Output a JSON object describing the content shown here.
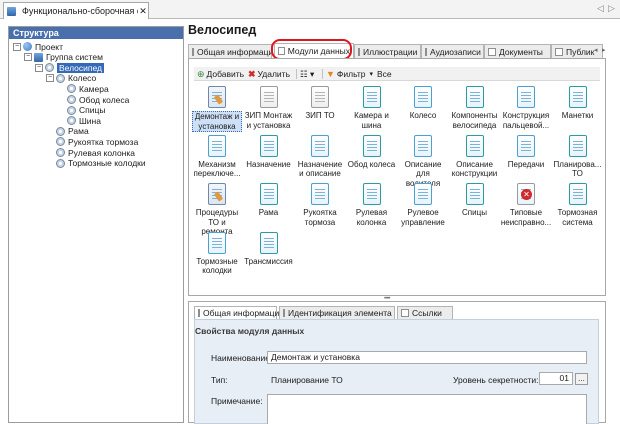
{
  "doc_tab": {
    "title": "Функционально-сборочная с",
    "close": "✕"
  },
  "nav": {
    "prev": "◁",
    "next": "▷"
  },
  "structure": {
    "header": "Структура",
    "tree": [
      {
        "label": "Проект",
        "depth": 0,
        "toggle": "−",
        "icon": "project-icon"
      },
      {
        "label": "Группа систем",
        "depth": 1,
        "toggle": "−",
        "icon": "group-icon"
      },
      {
        "label": "Велосипед",
        "depth": 2,
        "toggle": "−",
        "icon": "node-icon",
        "selected": true
      },
      {
        "label": "Колесо",
        "depth": 3,
        "toggle": "−",
        "icon": "node-icon"
      },
      {
        "label": "Камера",
        "depth": 4,
        "toggle": "",
        "icon": "node-icon"
      },
      {
        "label": "Обод колеса",
        "depth": 4,
        "toggle": "",
        "icon": "node-icon"
      },
      {
        "label": "Спицы",
        "depth": 4,
        "toggle": "",
        "icon": "node-icon"
      },
      {
        "label": "Шина",
        "depth": 4,
        "toggle": "",
        "icon": "node-icon"
      },
      {
        "label": "Рама",
        "depth": 3,
        "toggle": "",
        "icon": "node-icon"
      },
      {
        "label": "Рукоятка тормоза",
        "depth": 3,
        "toggle": "",
        "icon": "node-icon"
      },
      {
        "label": "Рулевая колонка",
        "depth": 3,
        "toggle": "",
        "icon": "node-icon"
      },
      {
        "label": "Тормозные колодки",
        "depth": 3,
        "toggle": "",
        "icon": "node-icon"
      }
    ]
  },
  "main": {
    "title": "Велосипед",
    "tabs": [
      {
        "label": "Общая информация",
        "active": false
      },
      {
        "label": "Модули данных",
        "active": true
      },
      {
        "label": "Иллюстрации",
        "active": false
      },
      {
        "label": "Аудиозаписи",
        "active": false
      },
      {
        "label": "Документы",
        "active": false
      },
      {
        "label": "Публик",
        "active": false
      }
    ],
    "tab_scroll": {
      "left": "◂",
      "right": "▸"
    },
    "highlight_color": "#e0161f",
    "toolbar": {
      "add": "Добавить",
      "delete": "Удалить",
      "view": "☷ ▾",
      "filter": "Фильтр",
      "filter_value": "Все"
    },
    "modules": [
      {
        "label": "Демонтаж и установка",
        "icon": "tool",
        "selected": true
      },
      {
        "label": "ЗИП Монтаж и установка",
        "icon": "grey"
      },
      {
        "label": "ЗИП ТО",
        "icon": "grey"
      },
      {
        "label": "Камера и шина",
        "icon": "doc"
      },
      {
        "label": "Колесо",
        "icon": "doc"
      },
      {
        "label": "Компоненты велосипеда",
        "icon": "doc"
      },
      {
        "label": "Конструкция пальцевой...",
        "icon": "doc"
      },
      {
        "label": "Манетки",
        "icon": "doc"
      },
      {
        "label": "Механизм переключе...",
        "icon": "doc"
      },
      {
        "label": "Назначение",
        "icon": "doc"
      },
      {
        "label": "Назначение и описание",
        "icon": "doc"
      },
      {
        "label": "Обод колеса",
        "icon": "doc"
      },
      {
        "label": "Описание для водителя",
        "icon": "doc"
      },
      {
        "label": "Описание конструкции",
        "icon": "doc"
      },
      {
        "label": "Передачи",
        "icon": "doc"
      },
      {
        "label": "Планирова... ТО",
        "icon": "doc"
      },
      {
        "label": "Процедуры ТО и ремонта",
        "icon": "tool"
      },
      {
        "label": "Рама",
        "icon": "doc"
      },
      {
        "label": "Рукоятка тормоза",
        "icon": "doc"
      },
      {
        "label": "Рулевая колонка",
        "icon": "doc"
      },
      {
        "label": "Рулевое управление",
        "icon": "doc"
      },
      {
        "label": "Спицы",
        "icon": "doc"
      },
      {
        "label": "Типовые неисправно...",
        "icon": "err"
      },
      {
        "label": "Тормозная система",
        "icon": "doc"
      },
      {
        "label": "Тормозные колодки",
        "icon": "doc"
      },
      {
        "label": "Трансмиссия",
        "icon": "doc"
      }
    ]
  },
  "splitter": "•••••",
  "details": {
    "tabs": [
      {
        "label": "Общая информация",
        "active": true
      },
      {
        "label": "Идентификация элемента",
        "active": false
      },
      {
        "label": "Ссылки",
        "active": false
      }
    ],
    "section_title": "Свойства модуля данных",
    "name_label": "Наименование:",
    "name_value": "Демонтаж и установка",
    "type_label": "Тип:",
    "type_value": "Планирование ТО",
    "security_label": "Уровень секретности:",
    "security_value": "01",
    "dots": "...",
    "note_label": "Примечание:"
  }
}
